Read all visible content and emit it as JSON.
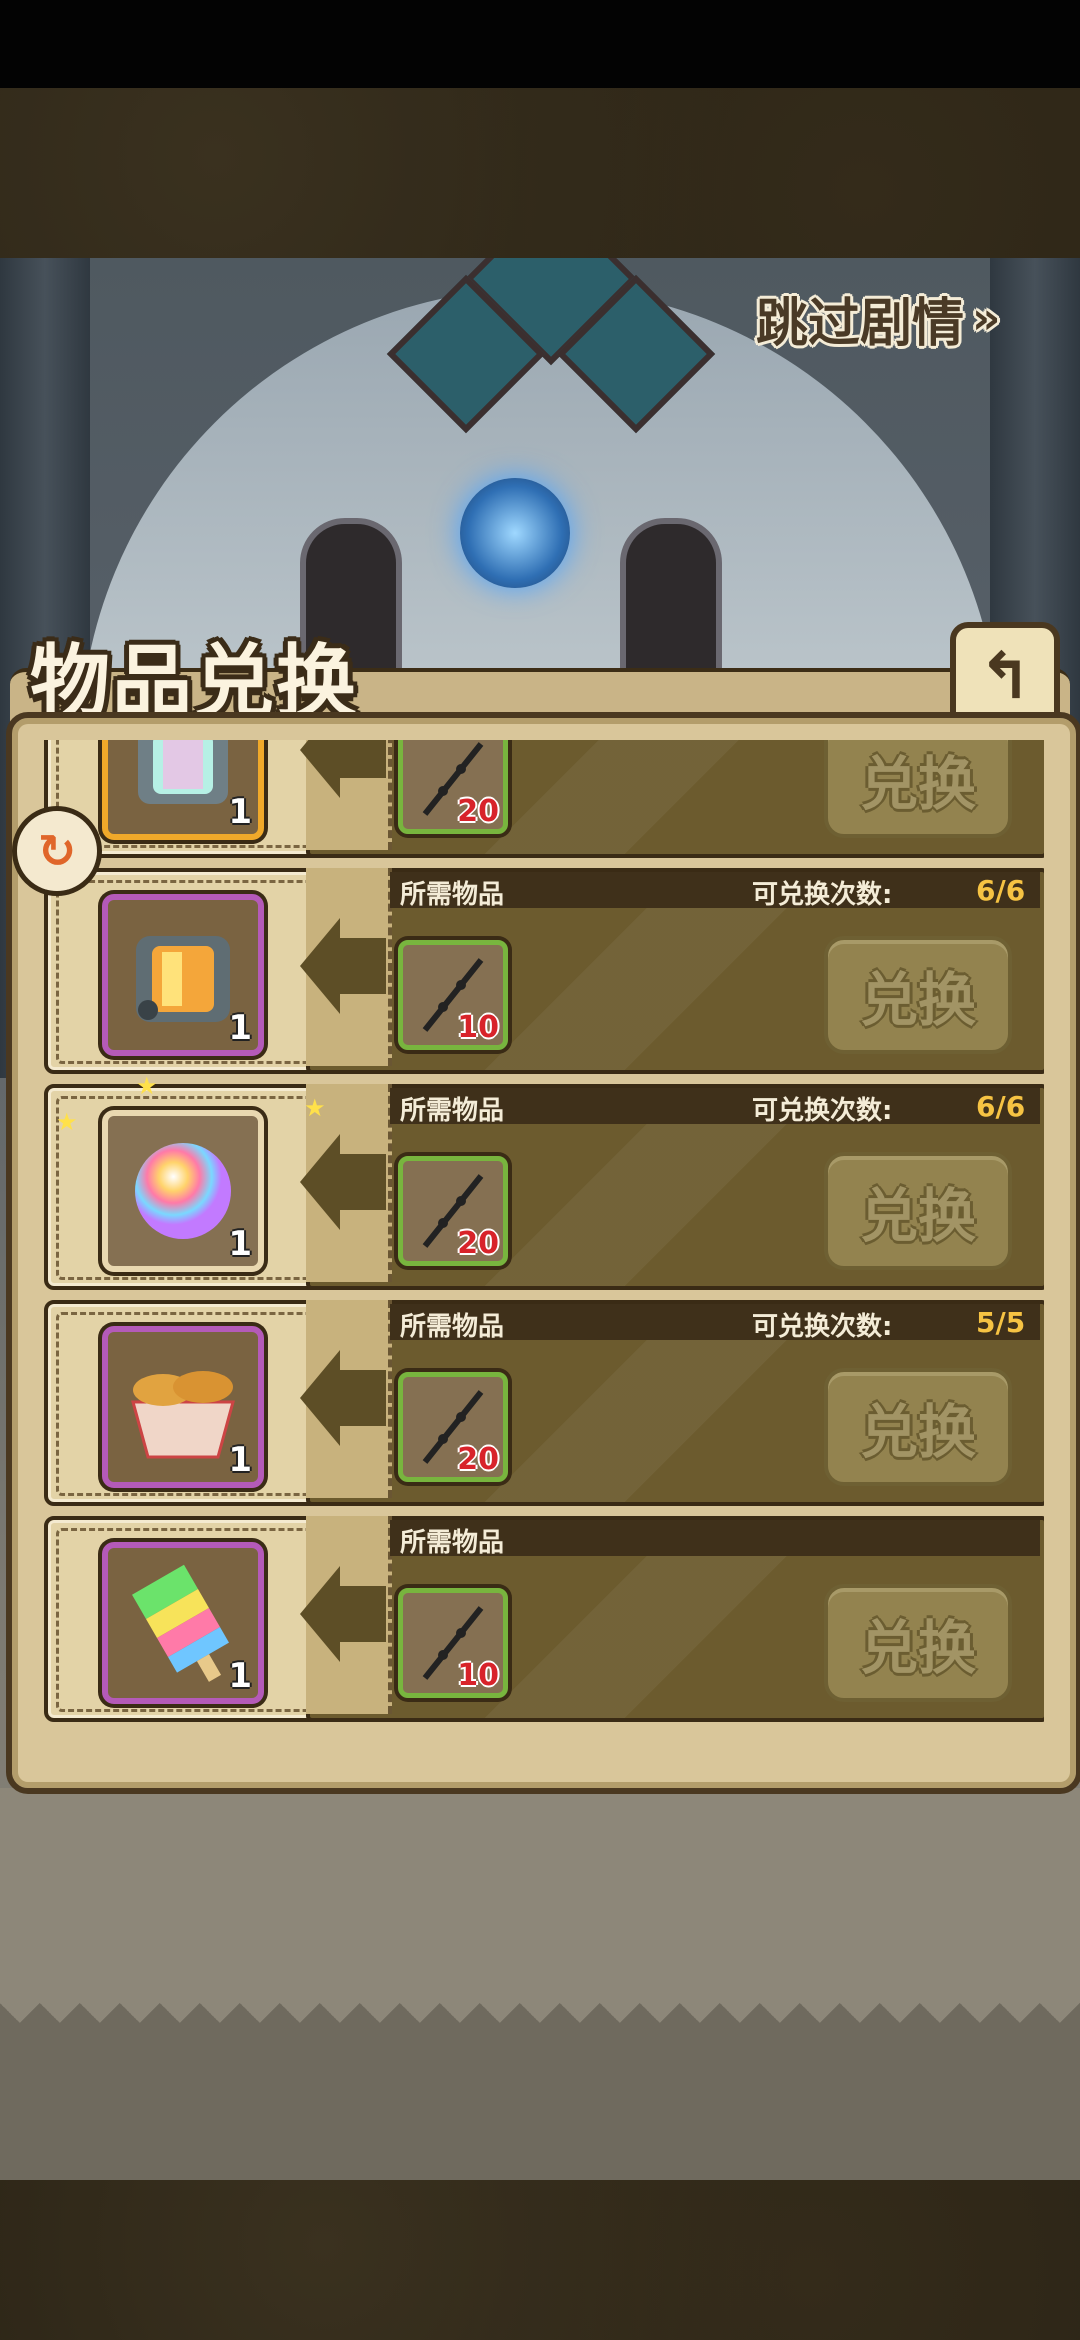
{
  "skip": {
    "label": "跳过剧情",
    "arrows": "»"
  },
  "title": "物品兑换",
  "back_icon": "↰",
  "list": {
    "required_label": "所需物品",
    "count_label": "可兑换次数:",
    "exchange_label": "兑换",
    "rows": [
      {
        "item": "lantern-rainbow-icon",
        "item_qty": "1",
        "req_qty": "20",
        "count": "",
        "frame": "orange"
      },
      {
        "item": "lantern-orange-icon",
        "item_qty": "1",
        "req_qty": "10",
        "count": "6/6",
        "frame": "purple"
      },
      {
        "item": "rainbow-orb-icon",
        "item_qty": "1",
        "req_qty": "20",
        "count": "6/6",
        "frame": "plain"
      },
      {
        "item": "bread-basket-icon",
        "item_qty": "1",
        "req_qty": "20",
        "count": "5/5",
        "frame": "purple"
      },
      {
        "item": "rainbow-popsicle-icon",
        "item_qty": "1",
        "req_qty": "10",
        "count": "",
        "frame": "purple"
      }
    ]
  },
  "scroll_badge_icon": "↻",
  "colors": {
    "header_bg": "#3f301a",
    "count_value": "#f6c343",
    "req_qty": "#d8232a",
    "frame_purple": "#b45ab8",
    "frame_orange": "#f0a92a"
  }
}
